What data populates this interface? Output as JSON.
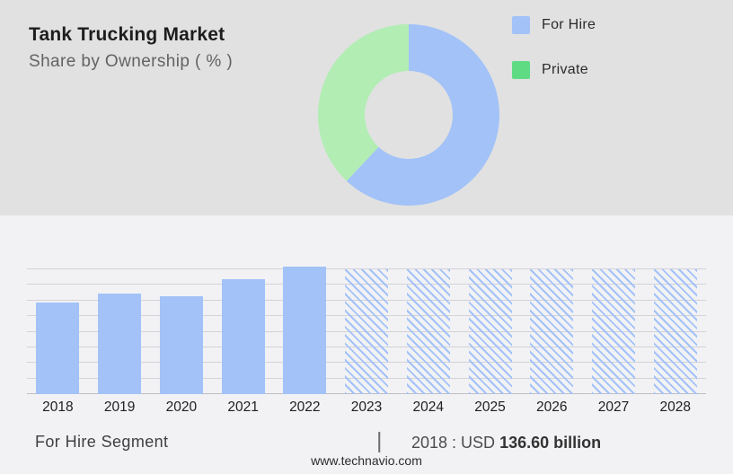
{
  "colors": {
    "top_bg": "#E1E1E1",
    "bottom_bg": "#F2F2F5",
    "accent_blue": "#A2C2F8",
    "donut_green": "#B2EDB4",
    "legend_green": "#5FDB84",
    "grid": "#D3D3D8",
    "axis": "#BEBEC4",
    "text_dark": "#1D1D1D",
    "text_gray": "#636363",
    "text_footer": "#3F3F3F"
  },
  "header": {
    "title": "Tank Trucking Market",
    "subtitle": "Share by Ownership ( % )"
  },
  "legend": {
    "items": [
      {
        "label": "For Hire",
        "color": "#A2C2F8"
      },
      {
        "label": "Private",
        "color": "#5FDB84"
      }
    ]
  },
  "footer": {
    "segment_label": "For Hire Segment",
    "separator": "|",
    "value_prefix": "2018 : USD",
    "value_bold": "136.60 billion",
    "website": "www.technavio.com"
  },
  "chart_data": [
    {
      "type": "pie",
      "title": "Share by Ownership ( % )",
      "donut": true,
      "inner_radius_ratio": 0.485,
      "start_angle_deg": 0,
      "legend_position": "right",
      "data_labels_shown": false,
      "slices": [
        {
          "label": "For Hire",
          "value_pct": 62,
          "color": "#A2C2F8"
        },
        {
          "label": "Private",
          "value_pct": 38,
          "color": "#B2EDB4"
        }
      ]
    },
    {
      "type": "bar",
      "title": "For Hire Segment",
      "xlabel": "",
      "ylabel": "",
      "y_axis_labels_shown": false,
      "gridline_count": 9,
      "categories": [
        "2018",
        "2019",
        "2020",
        "2021",
        "2022",
        "2023",
        "2024",
        "2025",
        "2026",
        "2027",
        "2028"
      ],
      "series": [
        {
          "name": "For Hire market size (USD billion)",
          "values": [
            136.6,
            150,
            146,
            171,
            190,
            null,
            null,
            null,
            null,
            null,
            null
          ]
        }
      ],
      "bar_height_pct": [
        73.4,
        80.6,
        78.4,
        92.1,
        102,
        100,
        100,
        100,
        100,
        100,
        100
      ],
      "bar_styles": [
        "solid",
        "solid",
        "solid",
        "solid",
        "solid",
        "hatched",
        "hatched",
        "hatched",
        "hatched",
        "hatched",
        "hatched"
      ],
      "forecast_years": [
        "2023",
        "2024",
        "2025",
        "2026",
        "2027",
        "2028"
      ],
      "anchor_label": "2018 : USD 136.60 billion",
      "note": "Only the 2018 value is labeled; 2019-2022 estimated from bar heights; hatched full-height bars mark the forecast period"
    }
  ]
}
